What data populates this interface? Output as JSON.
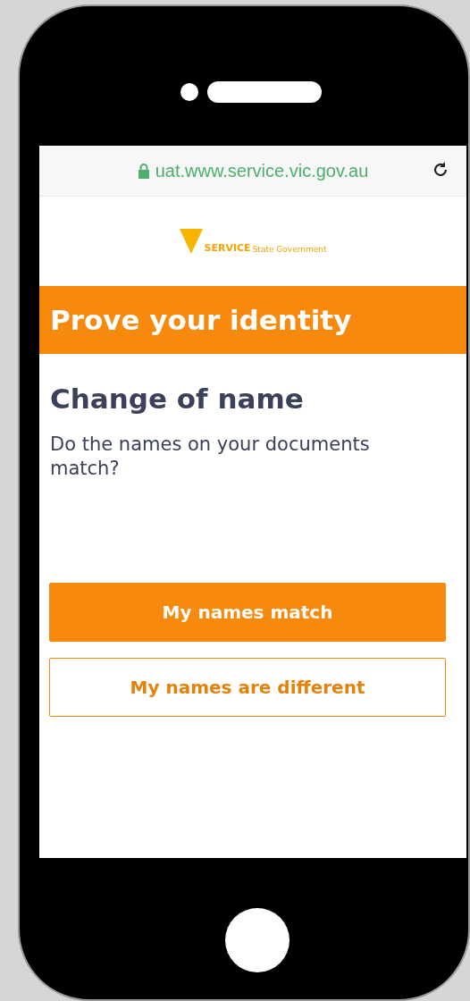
{
  "browser": {
    "url": "uat.www.service.vic.gov.au"
  },
  "logo": {
    "text": "SERVICE",
    "subtitle": "State Government"
  },
  "banner": {
    "title": "Prove your identity"
  },
  "content": {
    "heading": "Change of name",
    "question": "Do the names on your documents match?"
  },
  "buttons": [
    {
      "label": "My names match",
      "kind": "primary"
    },
    {
      "label": "My names are different",
      "kind": "secondary"
    }
  ]
}
